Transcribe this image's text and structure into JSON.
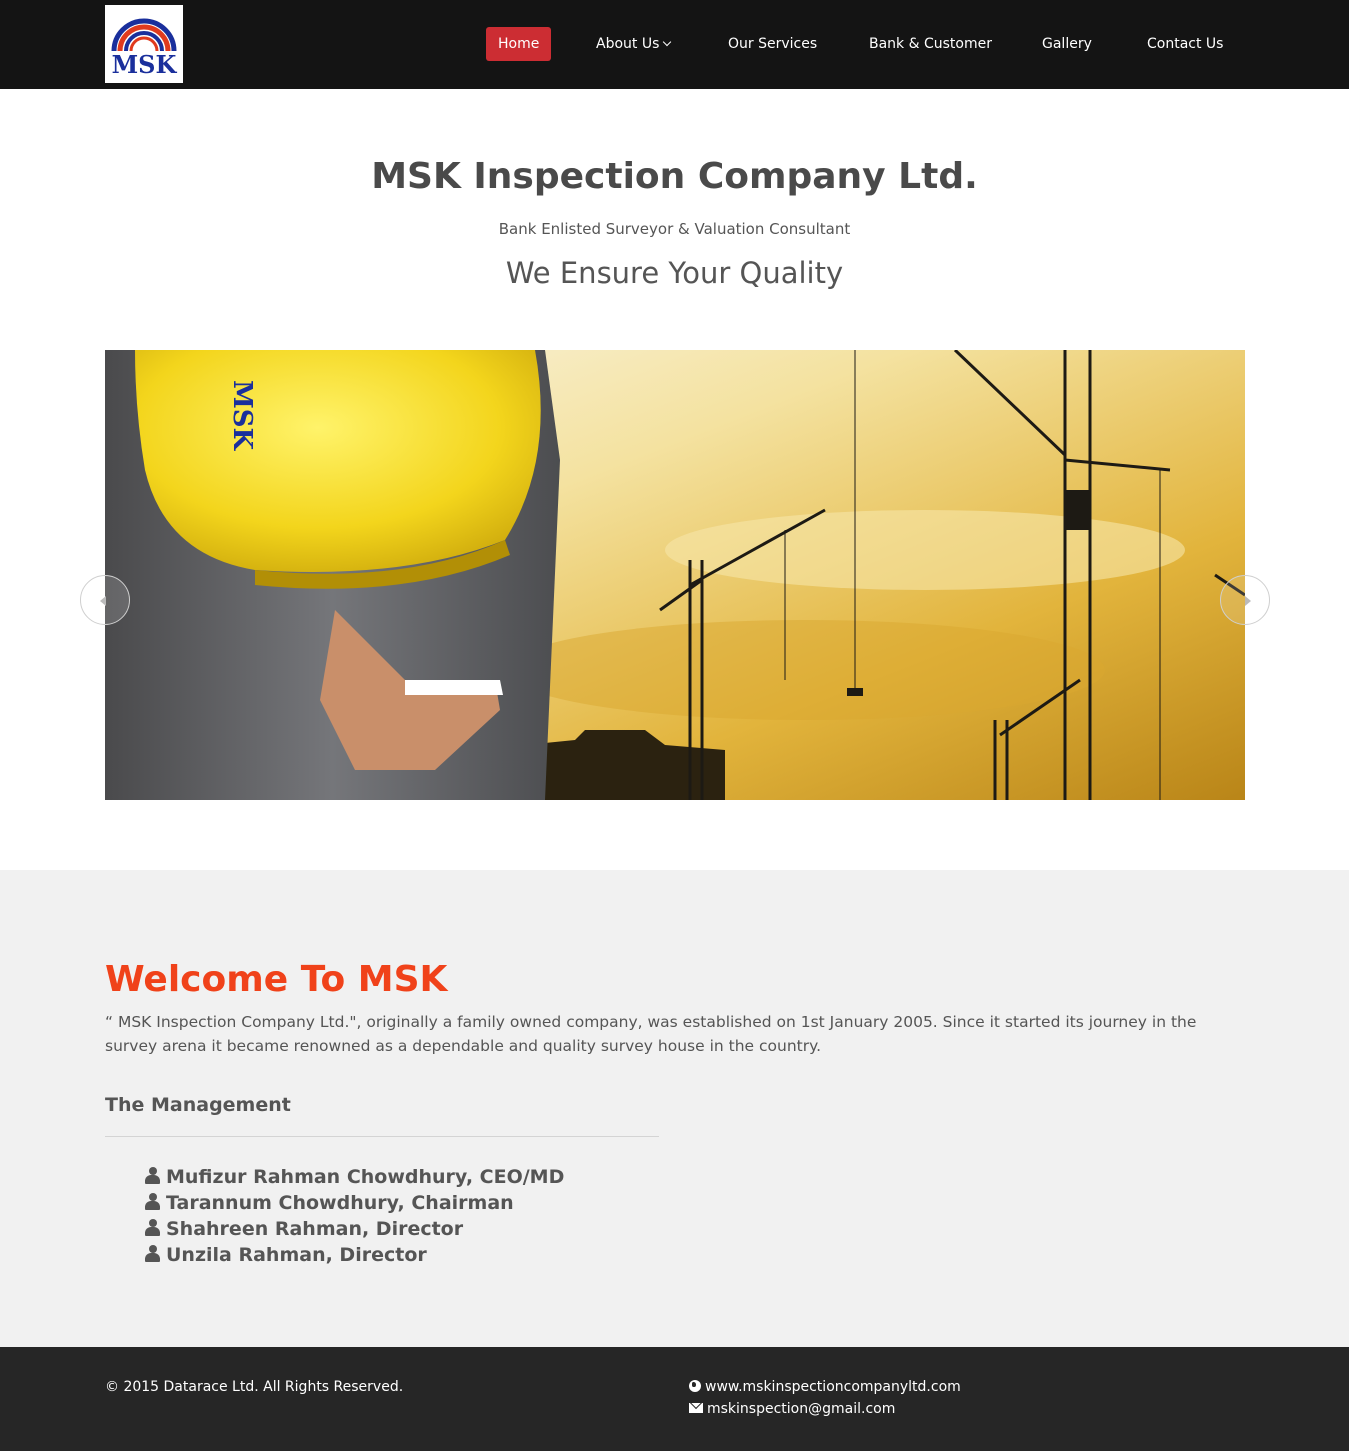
{
  "nav": {
    "logo_text": "MSK",
    "items": [
      {
        "label": "Home",
        "active": true
      },
      {
        "label": "About Us",
        "dropdown": true
      },
      {
        "label": "Our Services"
      },
      {
        "label": "Bank & Customer"
      },
      {
        "label": "Gallery"
      },
      {
        "label": "Contact Us"
      }
    ]
  },
  "hero": {
    "title": "MSK Inspection Company Ltd.",
    "subtitle": "Bank Enlisted Surveyor & Valuation Consultant",
    "tagline": "We Ensure Your Quality"
  },
  "slider": {
    "helmet_logo_text": "MSK",
    "prev_icon": "chevron-left-icon",
    "next_icon": "chevron-right-icon"
  },
  "welcome": {
    "title": "Welcome To MSK",
    "text": "“ MSK Inspection Company Ltd.\", originally a family owned company, was established on 1st January 2005. Since it started its journey in the survey arena it became renowned as a dependable and quality survey house in the country.",
    "management_title": "The Management",
    "management": [
      "Mufizur Rahman Chowdhury, CEO/MD",
      "Tarannum Chowdhury, Chairman",
      "Shahreen Rahman, Director",
      "Unzila Rahman, Director"
    ]
  },
  "footer": {
    "copyright": "© 2015 Datarace Ltd. All Rights Reserved.",
    "website": "www.mskinspectioncompanyltd.com",
    "email": "mskinspection@gmail.com"
  },
  "colors": {
    "nav_bg": "#141414",
    "nav_active": "#cc2d33",
    "welcome_title": "#f0421a",
    "section_bg": "#f1f1f1",
    "footer_bg": "#262626"
  }
}
